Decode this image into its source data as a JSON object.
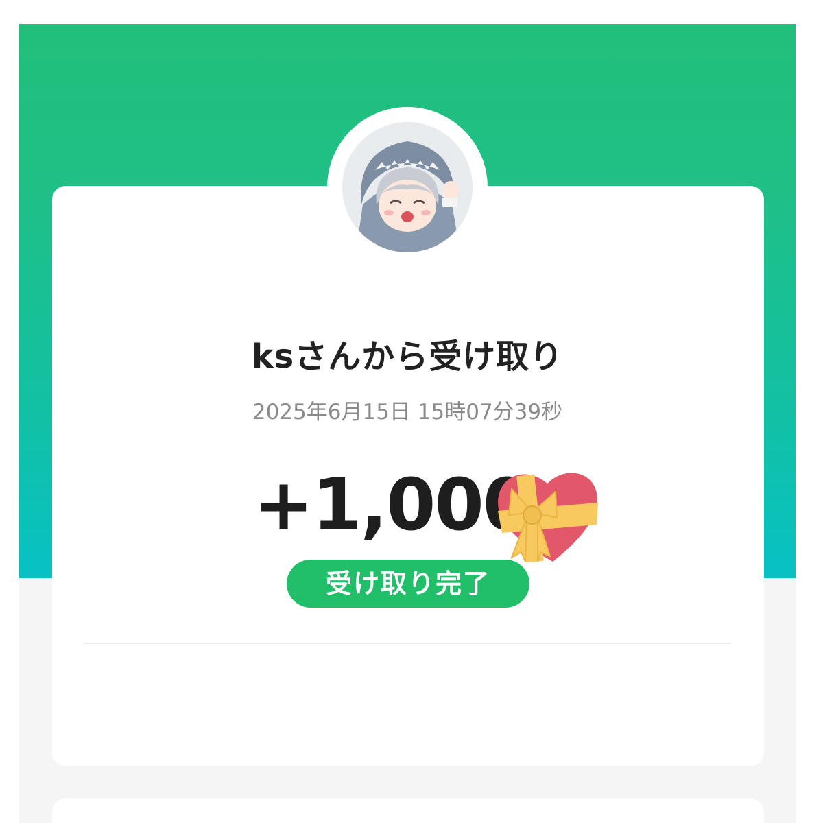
{
  "sender": {
    "title": "ksさんから受け取り",
    "avatar_description": "avatar-image"
  },
  "transaction": {
    "datetime": "2025年6月15日 15時07分39秒",
    "amount": "+1,000",
    "status": "受け取り完了"
  },
  "icons": {
    "gift_heart": "gift-heart-icon"
  },
  "colors": {
    "header_top": "#22bf7b",
    "header_bottom": "#07c1c4",
    "badge": "#22bf6b",
    "heart": "#e2586a",
    "ribbon": "#f7c95e"
  }
}
